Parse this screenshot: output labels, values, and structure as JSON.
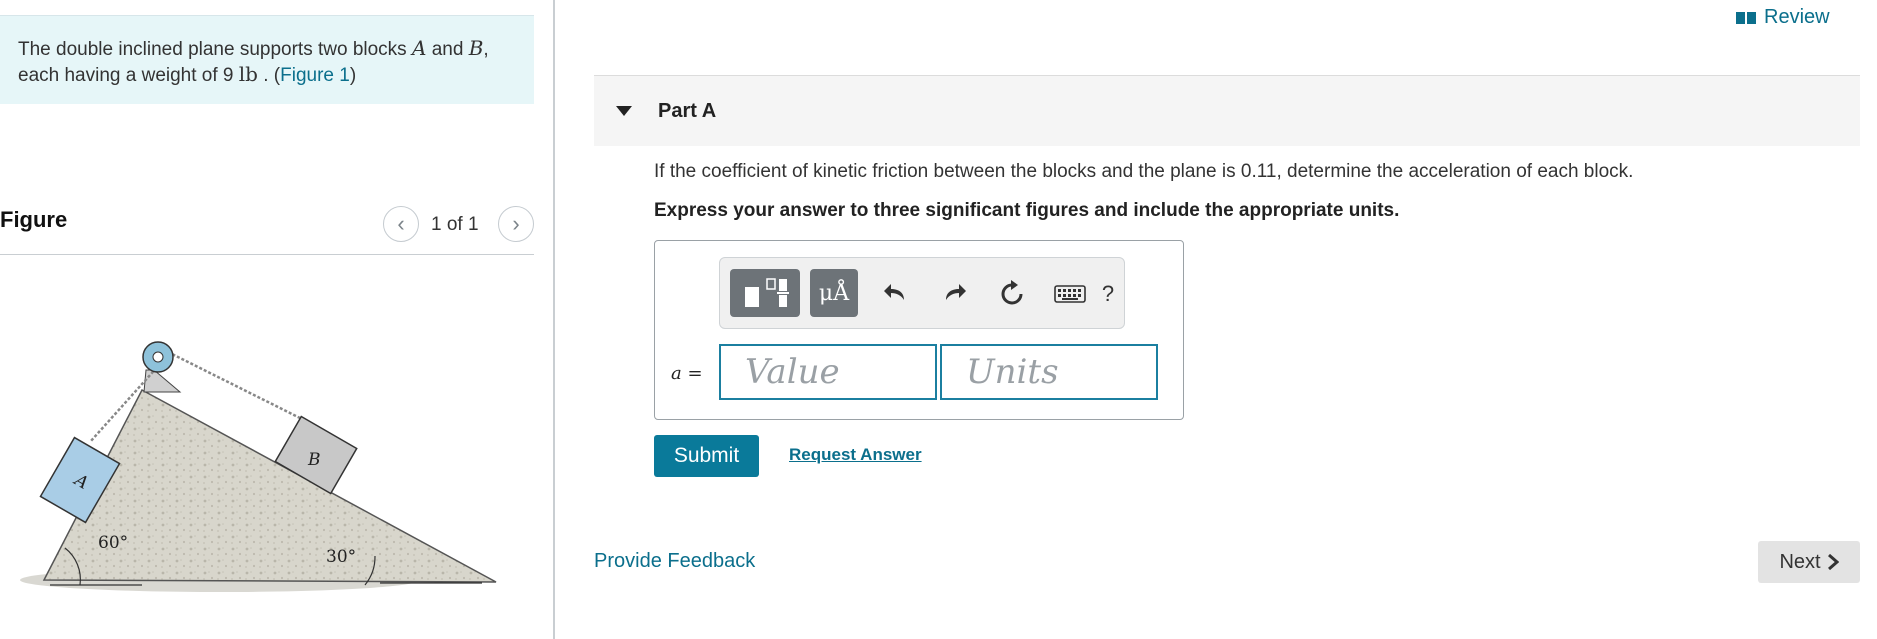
{
  "problem": {
    "text_before": "The double inclined plane supports two blocks ",
    "var_a": "A",
    "and": " and ",
    "var_b": "B",
    "comma": ",",
    "line2_before": "each having a weight of 9 ",
    "unit": "lb",
    "line2_after": " . (",
    "figure_link": "Figure 1",
    "close_paren": ")"
  },
  "figure": {
    "heading": "Figure",
    "pager": "1 of 1",
    "prev_icon": "chevron-left-icon",
    "next_icon": "chevron-right-icon",
    "block_a": "A",
    "block_b": "B",
    "angle_left": "60°",
    "angle_right": "30°"
  },
  "header": {
    "review": "Review",
    "review_icon": "book-icon"
  },
  "part": {
    "title": "Part A",
    "question": "If the coefficient of kinetic friction between the blocks and the plane is 0.11, determine the acceleration of each block.",
    "instruction": "Express your answer to three significant figures and include the appropriate units."
  },
  "answer": {
    "variable": "a =",
    "value_placeholder": "Value",
    "units_placeholder": "Units",
    "toolbar": {
      "template_icon": "templates-icon",
      "units_btn": "μÅ",
      "undo_icon": "undo-icon",
      "redo_icon": "redo-icon",
      "reset_icon": "reset-icon",
      "keyboard_icon": "keyboard-icon",
      "help": "?"
    }
  },
  "actions": {
    "submit": "Submit",
    "request_answer": "Request Answer",
    "provide_feedback": "Provide Feedback",
    "next": "Next"
  },
  "colors": {
    "accent": "#0b6f8c",
    "button": "#0a7a9a",
    "problem_bg": "#e6f6f8",
    "block_a": "#a9cde6",
    "block_b": "#c8c8c8"
  }
}
